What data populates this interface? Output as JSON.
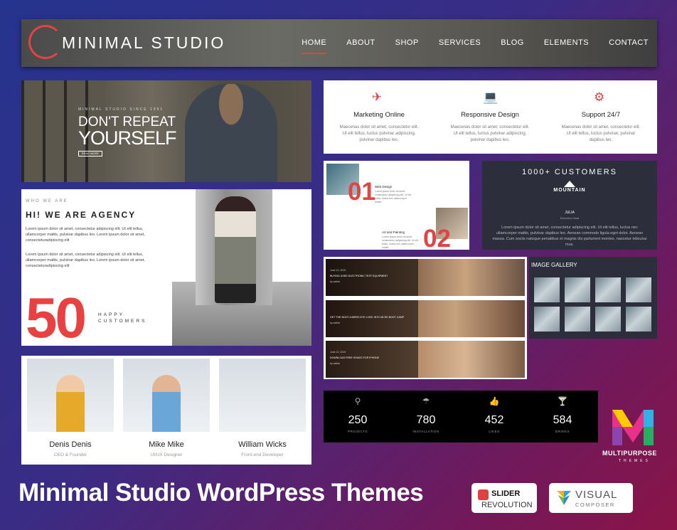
{
  "nav": {
    "logo": "MINIMAL STUDIO",
    "menu": [
      "HOME",
      "ABOUT",
      "SHOP",
      "SERVICES",
      "BLOG",
      "ELEMENTS",
      "CONTACT"
    ]
  },
  "hero": {
    "kicker": "MINIMAL STUDIO SINCE 1991",
    "line1": "DON'T REPEAT",
    "line2": "YOURSELF",
    "button": "READ MORE"
  },
  "agency": {
    "who": "WHO WE ARE",
    "heading": "HI! WE ARE AGENCY",
    "p1": "Lorem ipsum dolor sit amet, consectetur adipiscing elit. Ut elit tellus, ullamcorper mattis, pulvinar dapibus leo. Lorem ipsum dolor sit amet, consecteturadipiscing elit",
    "p2": "Lorem ipsum dolor sit amet, consectetur adipiscing elit. Ut elit tellus, ullamcorper mattis, pulvinar dapibus leo. Lorem ipsum dolor sit amet, consecteturadipiscing elit",
    "number": "50",
    "happy1": "HAPPY",
    "happy2": "CUSTOMERS"
  },
  "team": [
    {
      "name": "Denis Denis",
      "role": "CEO & Founder"
    },
    {
      "name": "Mike Mike",
      "role": "UI/UX Designer"
    },
    {
      "name": "William Wicks",
      "role": "Front-end Developer"
    }
  ],
  "features": [
    {
      "icon": "✈",
      "title": "Marketing Online",
      "desc": "Maecenas dolor sit amet, consectetur elit. Ut elit tellus, luctus pulvinar adipiscing, pulvinar dapibus leo."
    },
    {
      "icon": "💻",
      "title": "Responsive Design",
      "desc": "Maecenas dolor sit amet, consectetur elit. Ut elit tellus, luctus pulvinar adipiscing, pulvinar dapibus leo."
    },
    {
      "icon": "⚙",
      "title": "Support 24/7",
      "desc": "Maecenas dolor sit amet, consectetur elit. Ut elit tellus, luctus pulvinar, pulvinar dapibus leo."
    }
  ],
  "process": {
    "n1": "01",
    "t1": "Web Design",
    "d1": "Lorem ipsum dolor sit amet, consectetur adipiscing elit. Ut elit tellus, luctus nec ullamcorper mattis",
    "n2": "02",
    "t2": "Art and Painting",
    "d2": "Lorem ipsum dolor sit amet, consectetur adipiscing elit. Ut elit tellus, luctus nec ullamcorper mattis"
  },
  "customers": {
    "heading": "1000+ CUSTOMERS",
    "brand": "MOUNTAIN",
    "name": "JULIA",
    "role": "Executive Head",
    "quote": "Lorem ipsum dolor sit amet, consectetur adipiscing elit. Ut elit tellus, luctus nec ullamcorper mattis, pulvinar dapibus leo. Aenean commodo ligula eget dolor. Aenean massa. Cum sociis natoque penatibus et magnis dis parturient montes, nascetur ridiculus mus."
  },
  "blog": [
    {
      "date": "June 12, 2019",
      "title": "BUYING USED ELECTRONIC TEST EQUIPMENT",
      "by": "by admin"
    },
    {
      "date": "June 12, 2019",
      "title": "GET THE BOOT A BIRDS EYE LOOK INTO MCSE BOOT CAMP",
      "by": "by admin"
    },
    {
      "date": "June 12, 2019",
      "title": "DOWNLOAD FREE SONGS FOR IPHONE",
      "by": "by admin"
    }
  ],
  "gallery": {
    "heading": "IMAGE GALLERY"
  },
  "stats": [
    {
      "icon": "⚲",
      "value": "250",
      "label": "PROJECTS"
    },
    {
      "icon": "☂",
      "value": "780",
      "label": "INSTALLATION"
    },
    {
      "icon": "👍",
      "value": "452",
      "label": "LIKES"
    },
    {
      "icon": "🍸",
      "value": "584",
      "label": "DRINKS"
    }
  ],
  "brand_badge": {
    "line1": "MULTIPURPOSE",
    "line2": "THEMES"
  },
  "footer_title": "Minimal Studio WordPress Themes",
  "slider": {
    "line1": "SLIDER",
    "line2": "REVOLUTION"
  },
  "composer": {
    "line1": "VISUAL",
    "line2": "COMPOSER"
  },
  "colors": {
    "accent": "#e04444",
    "dark": "#2c2f3b"
  }
}
